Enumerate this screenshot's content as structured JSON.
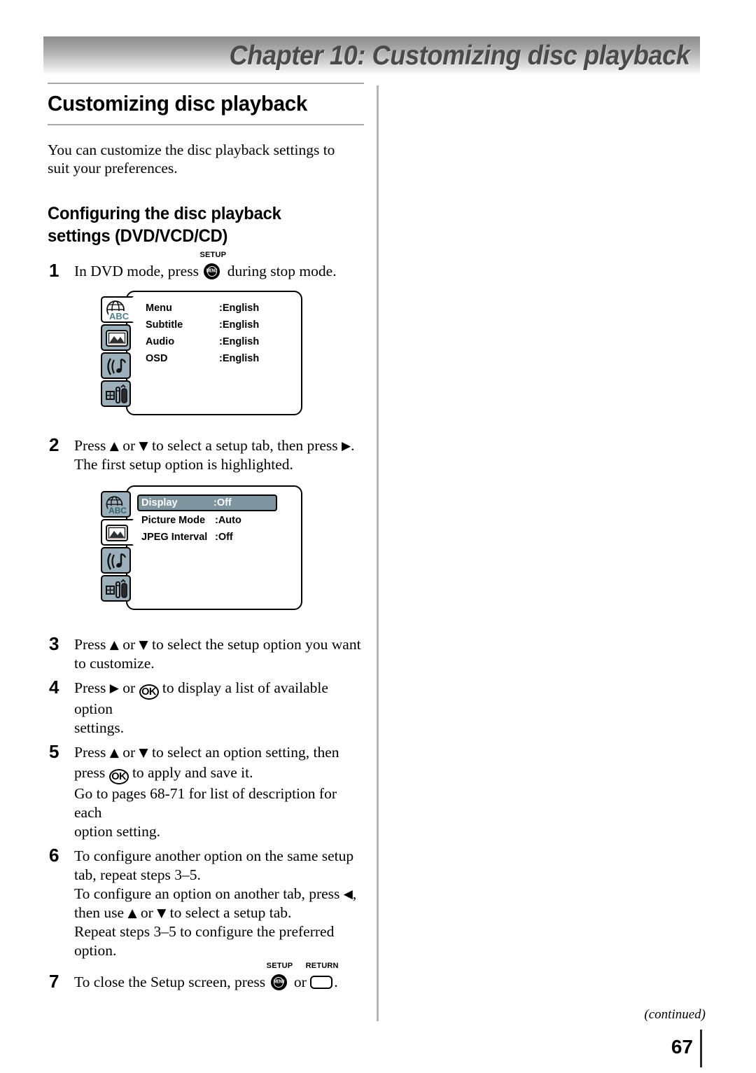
{
  "header": {
    "chapter_title": "Chapter 10: Customizing disc playback"
  },
  "page": {
    "title": "Customizing disc playback",
    "intro": "You can customize the disc playback settings to suit your preferences.",
    "section_heading": "Configuring the disc playback settings (DVD/VCD/CD)",
    "page_number": "67",
    "continued_note": "(continued)"
  },
  "keys": {
    "setup_caption": "SETUP",
    "setup_inner": "MENU",
    "return_caption": "RETURN",
    "ok_label": "OK",
    "up_arrow": "▲",
    "down_arrow": "▼",
    "right_arrow": "▶",
    "left_arrow": "◀"
  },
  "steps": [
    {
      "num": "1",
      "lines": [
        "In DVD mode, press ",
        " during stop mode."
      ]
    },
    {
      "num": "2",
      "line1_a": "Press ",
      "line1_b": " or ",
      "line1_c": " to select a setup tab, then press ",
      "line1_d": ".",
      "line2": "The first setup option is highlighted."
    },
    {
      "num": "3",
      "line1_a": "Press ",
      "line1_b": " or ",
      "line1_c": " to select the setup option you want",
      "line2": "to customize."
    },
    {
      "num": "4",
      "line1_a": "Press ",
      "line1_b": " or ",
      "line1_c": " to display a list of available option",
      "line2": "settings."
    },
    {
      "num": "5",
      "line1_a": "Press ",
      "line1_b": " or ",
      "line1_c": " to select an option setting, then",
      "line2_a": "press ",
      "line2_b": " to apply and save it.",
      "line3": "Go to pages 68-71 for list of description for each",
      "line4": "option setting."
    },
    {
      "num": "6",
      "line1": "To configure another option on the same setup",
      "line2": "tab, repeat steps 3–5.",
      "line3_a": "To configure an option on another tab, press ",
      "line3_b": ",",
      "line4_a": "then use ",
      "line4_b": " or ",
      "line4_c": " to select a setup tab.",
      "line5": "Repeat steps 3–5 to configure the preferred",
      "line6": "option."
    },
    {
      "num": "7",
      "line1_a": "To close the Setup screen, press ",
      "line1_b": " or ",
      "line1_c": "."
    }
  ],
  "osd_figure_1": {
    "active_tab_index": 0,
    "tabs": [
      "language-globe-abc-icon",
      "picture-display-icon",
      "audio-note-icon",
      "settings-tools-icon"
    ],
    "rows": [
      {
        "label": "Menu",
        "value": ":English",
        "highlighted": false
      },
      {
        "label": "Subtitle",
        "value": ":English",
        "highlighted": false
      },
      {
        "label": "Audio",
        "value": ":English",
        "highlighted": false
      },
      {
        "label": "OSD",
        "value": ":English",
        "highlighted": false
      }
    ]
  },
  "osd_figure_2": {
    "active_tab_index": 1,
    "tabs": [
      "language-globe-abc-icon",
      "picture-display-icon",
      "audio-note-icon",
      "settings-tools-icon"
    ],
    "rows": [
      {
        "label": "Display",
        "value": ":Off",
        "highlighted": true
      },
      {
        "label": "Picture Mode",
        "value": ":Auto",
        "highlighted": false
      },
      {
        "label": "JPEG Interval",
        "value": ":Off",
        "highlighted": false
      }
    ]
  },
  "colors": {
    "tab_fill": "#9bb0bb",
    "highlight_fill": "#7e949e",
    "banner_gray": "#9a9a9a",
    "rule_gray": "#a8a8a8"
  }
}
